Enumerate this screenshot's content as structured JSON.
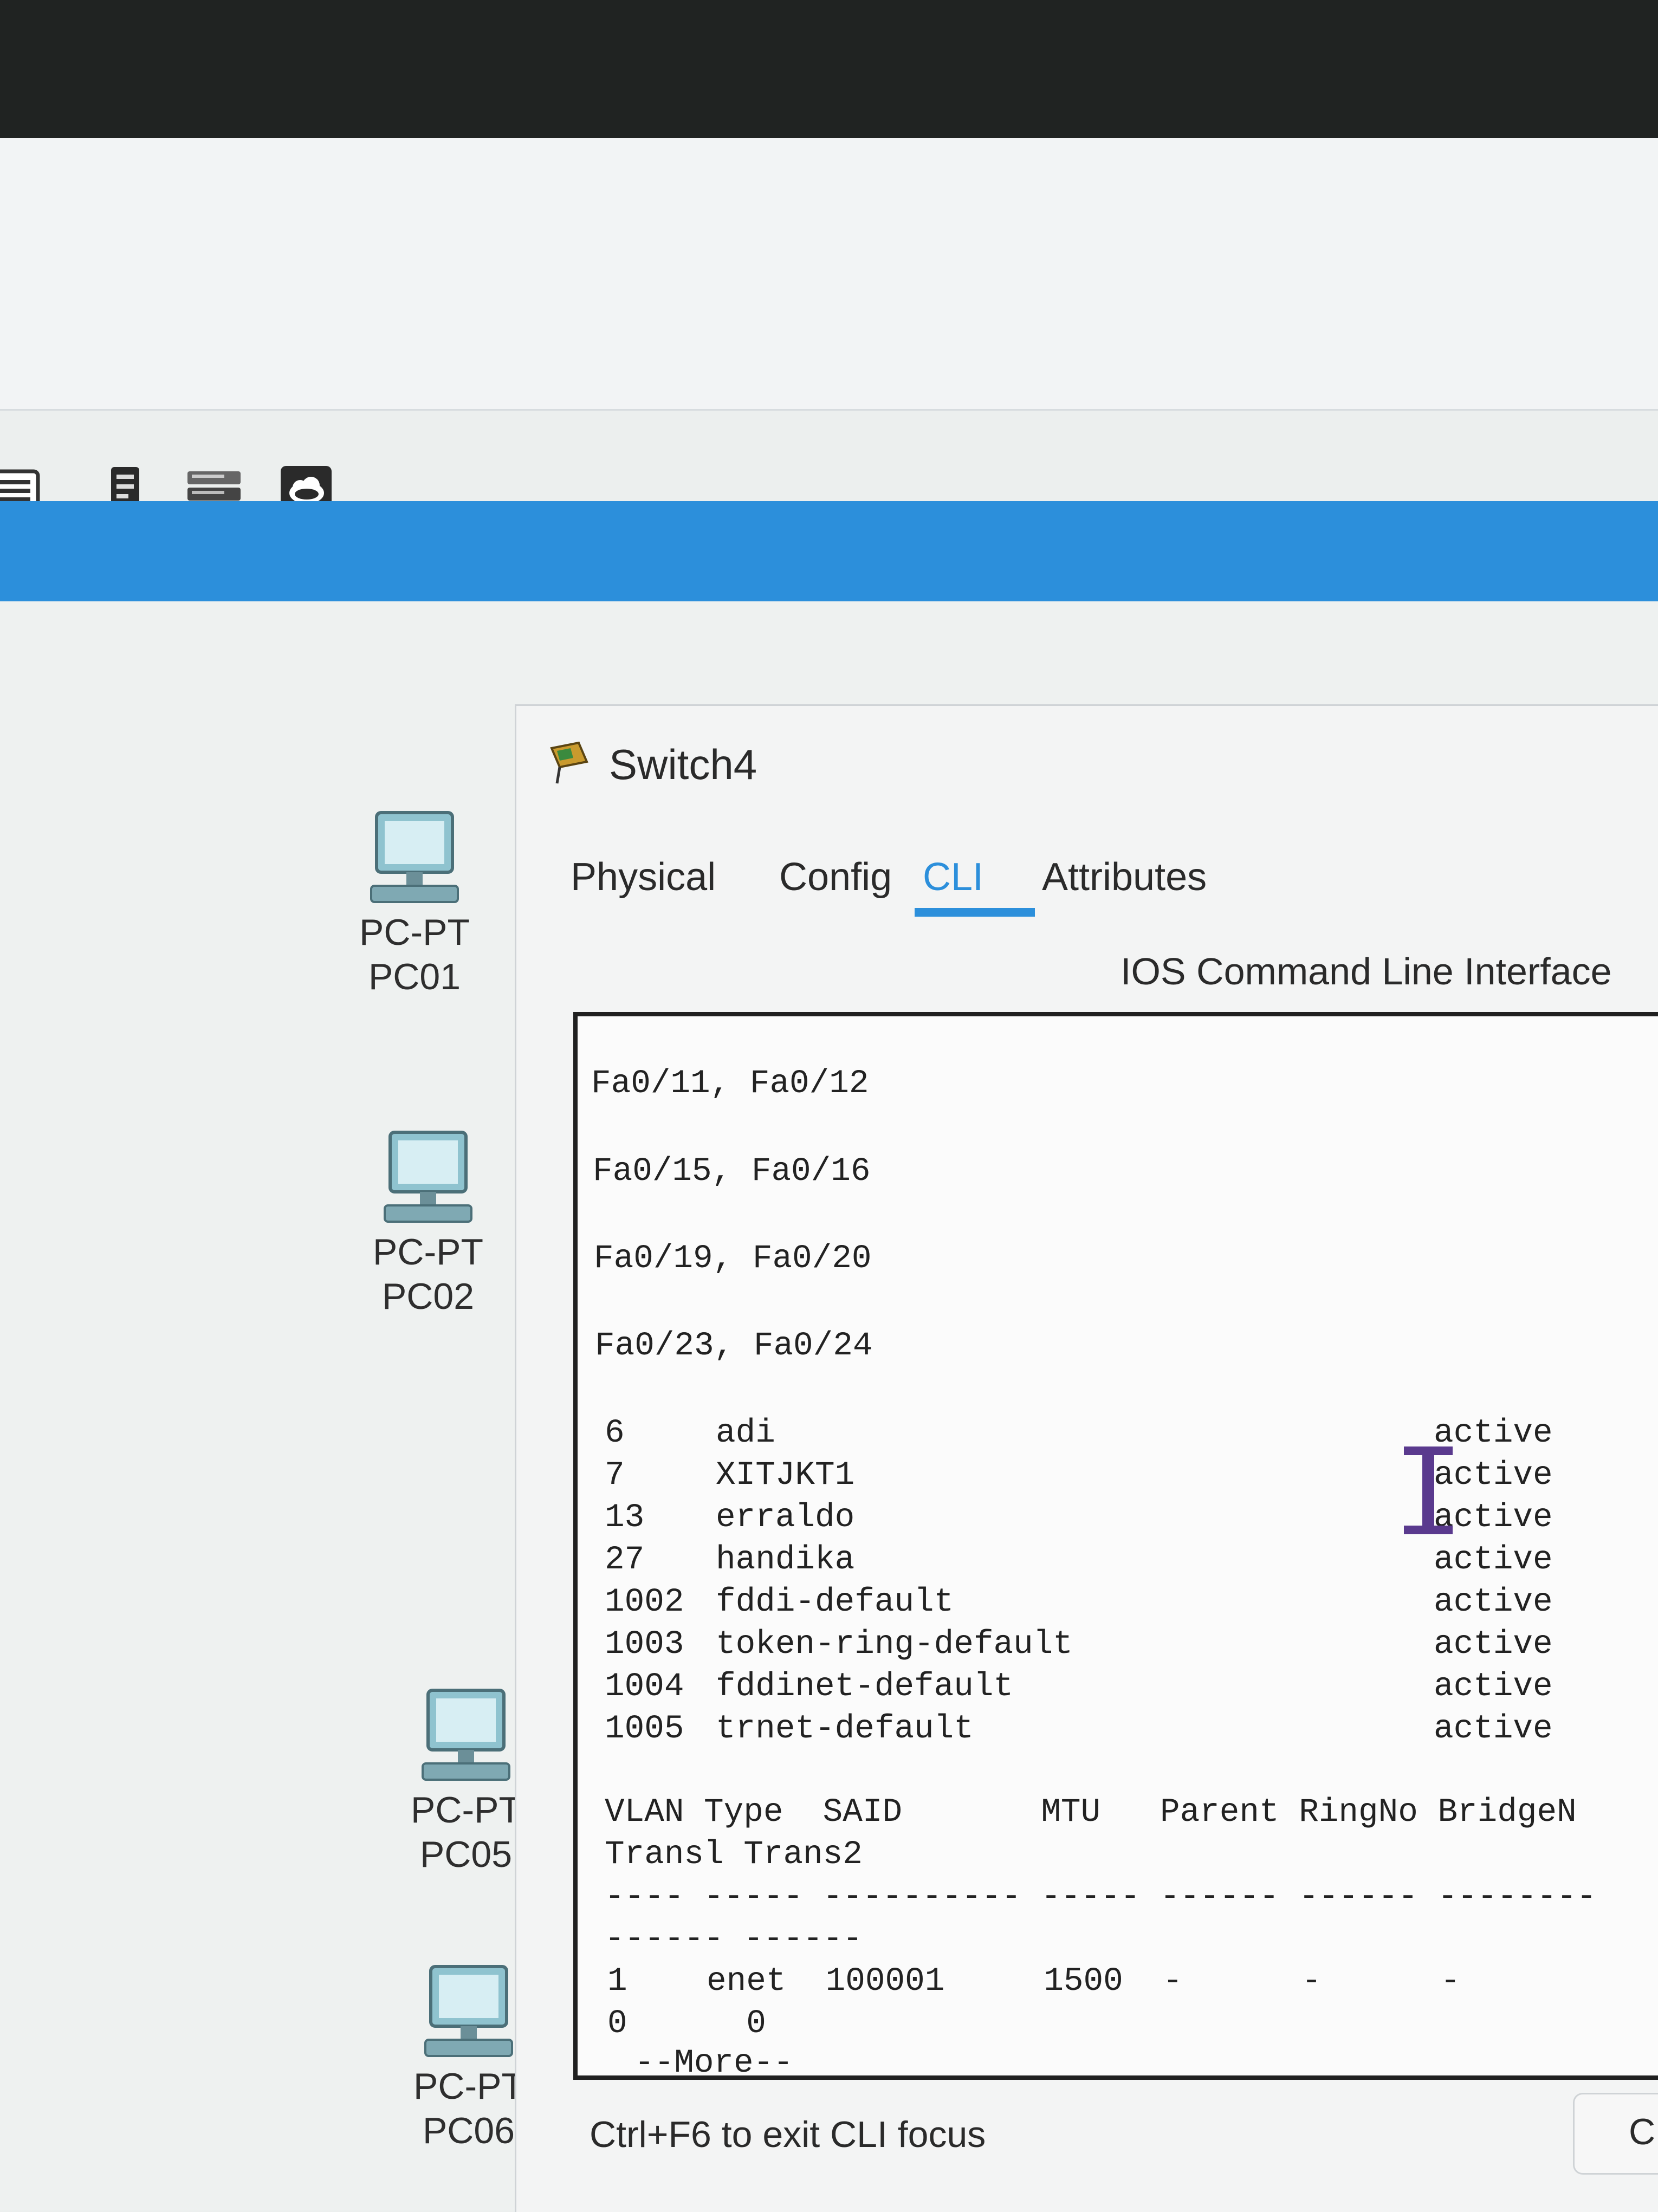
{
  "toolbar": {
    "buttons": [
      {
        "icon": "list-icon"
      },
      {
        "icon": "server-icon"
      },
      {
        "icon": "switch-rack-icon"
      },
      {
        "icon": "cloud-icon"
      }
    ]
  },
  "devices": [
    {
      "type": "PC-PT",
      "name": "PC01"
    },
    {
      "type": "PC-PT",
      "name": "PC02"
    },
    {
      "type": "PC-PT",
      "name": "PC05"
    },
    {
      "type": "PC-PT",
      "name": "PC06"
    }
  ],
  "window": {
    "title": "Switch4",
    "tabs": [
      "Physical",
      "Config",
      "CLI",
      "Attributes"
    ],
    "active_tab": "CLI",
    "cli_header": "IOS Command Line Interface",
    "hint": "Ctrl+F6 to exit CLI focus",
    "corner_button_label": "C"
  },
  "console": {
    "port_lines": [
      "Fa0/11, Fa0/12",
      "Fa0/15, Fa0/16",
      "Fa0/19, Fa0/20",
      "Fa0/23, Fa0/24"
    ],
    "vlans": [
      {
        "id": "6",
        "name": "adi",
        "status": "active"
      },
      {
        "id": "7",
        "name": "XITJKT1",
        "status": "active"
      },
      {
        "id": "13",
        "name": "erraldo",
        "status": "active"
      },
      {
        "id": "27",
        "name": "handika",
        "status": "active"
      },
      {
        "id": "1002",
        "name": "fddi-default",
        "status": "active"
      },
      {
        "id": "1003",
        "name": "token-ring-default",
        "status": "active"
      },
      {
        "id": "1004",
        "name": "fddinet-default",
        "status": "active"
      },
      {
        "id": "1005",
        "name": "trnet-default",
        "status": "active"
      }
    ],
    "header_line1": "VLAN Type  SAID       MTU   Parent RingNo BridgeN",
    "header_line2": "Transl Trans2",
    "dash_line1": "---- ----- ---------- ----- ------ ------ --------",
    "dash_line2": "------ ------",
    "data_line1": "1    enet  100001     1500  -      -      -",
    "data_line2": "0      0",
    "more": "--More--"
  },
  "colors": {
    "accent": "#2c8fdb",
    "console_bg": "#fbfbfb",
    "cursor": "#5a3a8e"
  }
}
